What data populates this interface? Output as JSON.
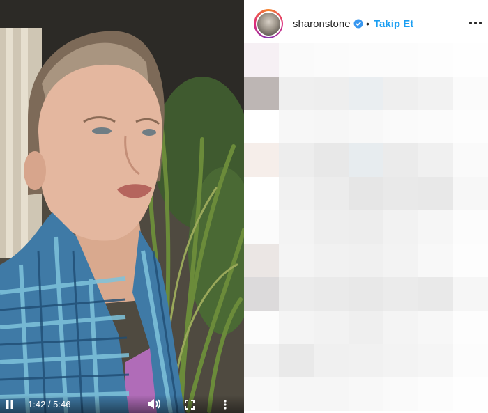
{
  "video": {
    "time_label": "1:42 / 5:46",
    "progress_fraction": 0.295,
    "controls": {
      "play_pause_icon": "pause-icon",
      "volume_icon": "volume-icon",
      "fullscreen_icon": "fullscreen-icon",
      "more_icon": "more-vertical-icon"
    }
  },
  "post": {
    "username": "sharonstone",
    "verified_icon": "verified-badge-icon",
    "separator": "•",
    "follow_label": "Takip Et",
    "more_icon": "more-horizontal-icon",
    "accent_color": "#1a9ef2",
    "comments_blurred": true
  }
}
